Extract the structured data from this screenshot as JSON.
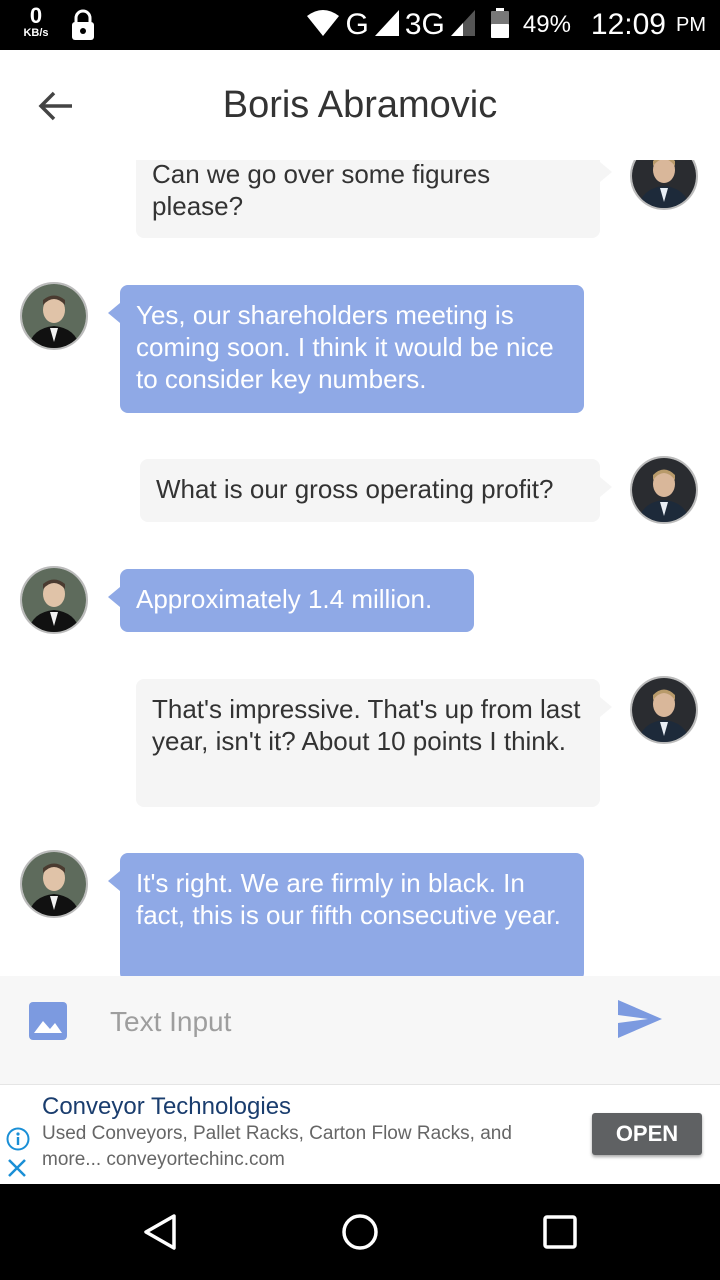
{
  "status_bar": {
    "speed_value": "0",
    "speed_unit": "KB/s",
    "network_1": "G",
    "network_2": "3G",
    "battery_percent": "49%",
    "time": "12:09",
    "ampm": "PM"
  },
  "header": {
    "title": "Boris Abramovic"
  },
  "messages": [
    {
      "side": "sent",
      "text": "Can we go over some figures please?"
    },
    {
      "side": "received",
      "text": "Yes, our shareholders meeting is coming soon. I think it would be nice to consider key numbers."
    },
    {
      "side": "sent",
      "text": "What is our gross operating profit?"
    },
    {
      "side": "received",
      "text": "Approximately 1.4 million."
    },
    {
      "side": "sent",
      "text": "That's impressive. That's up from last year, isn't it? About 10 points I think."
    },
    {
      "side": "received",
      "text": "It's right. We are firmly in black. In fact, this is our fifth consecutive year."
    }
  ],
  "input": {
    "placeholder": "Text Input",
    "value": ""
  },
  "ad": {
    "title": "Conveyor Technologies",
    "description": "Used Conveyors, Pallet Racks, Carton Flow Racks, and more... conveyortechinc.com",
    "button": "OPEN"
  },
  "colors": {
    "received_bubble": "#8fa9e6",
    "sent_bubble": "#f5f5f5",
    "accent": "#7c9ae0",
    "ad_title": "#1a3d6e"
  }
}
